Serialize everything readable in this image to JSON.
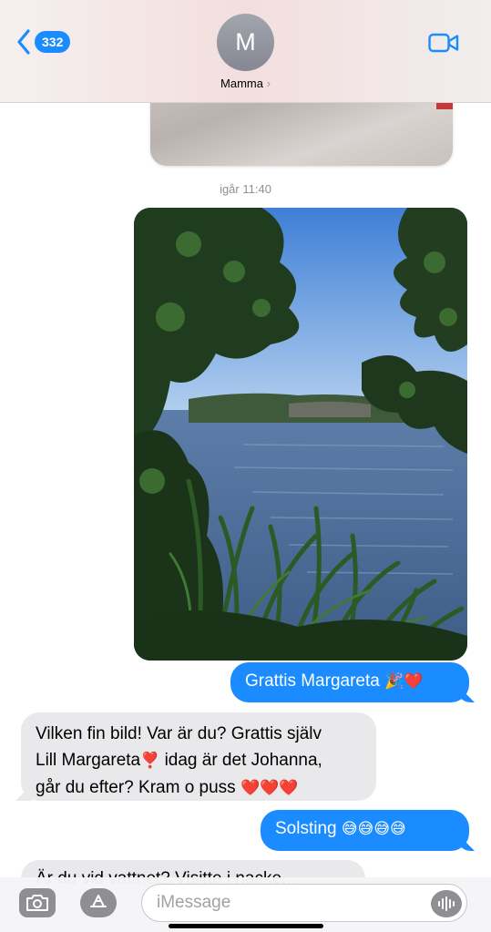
{
  "header": {
    "back_count": "332",
    "avatar_initial": "M",
    "contact_name": "Mamma",
    "name_chevron": "›"
  },
  "conversation": {
    "timestamp": "igår 11:40",
    "messages": [
      {
        "direction": "outgoing",
        "text": "Grattis Margareta",
        "emoji": "🎉❤️"
      },
      {
        "direction": "incoming",
        "line1": "Vilken fin bild! Var är du? Grattis själv",
        "line2_a": "Lill Margareta",
        "line2_emoji": "❣️",
        "line2_b": "idag är det Johanna,",
        "line3": "går du efter? Kram o puss",
        "line3_emoji": "❤️❤️❤️"
      },
      {
        "direction": "outgoing",
        "text": "Solsting",
        "emoji": "😅😅😅😅"
      },
      {
        "direction": "incoming",
        "text": "Är du vid vattnet? Visitte i nacke..."
      }
    ]
  },
  "composer": {
    "placeholder": "iMessage"
  },
  "colors": {
    "accent": "#1a8cff",
    "incoming_bubble": "#e9e9eb"
  },
  "icons": [
    "chevron-left-icon",
    "video-camera-icon",
    "camera-icon",
    "app-store-icon",
    "audio-waveform-icon"
  ]
}
